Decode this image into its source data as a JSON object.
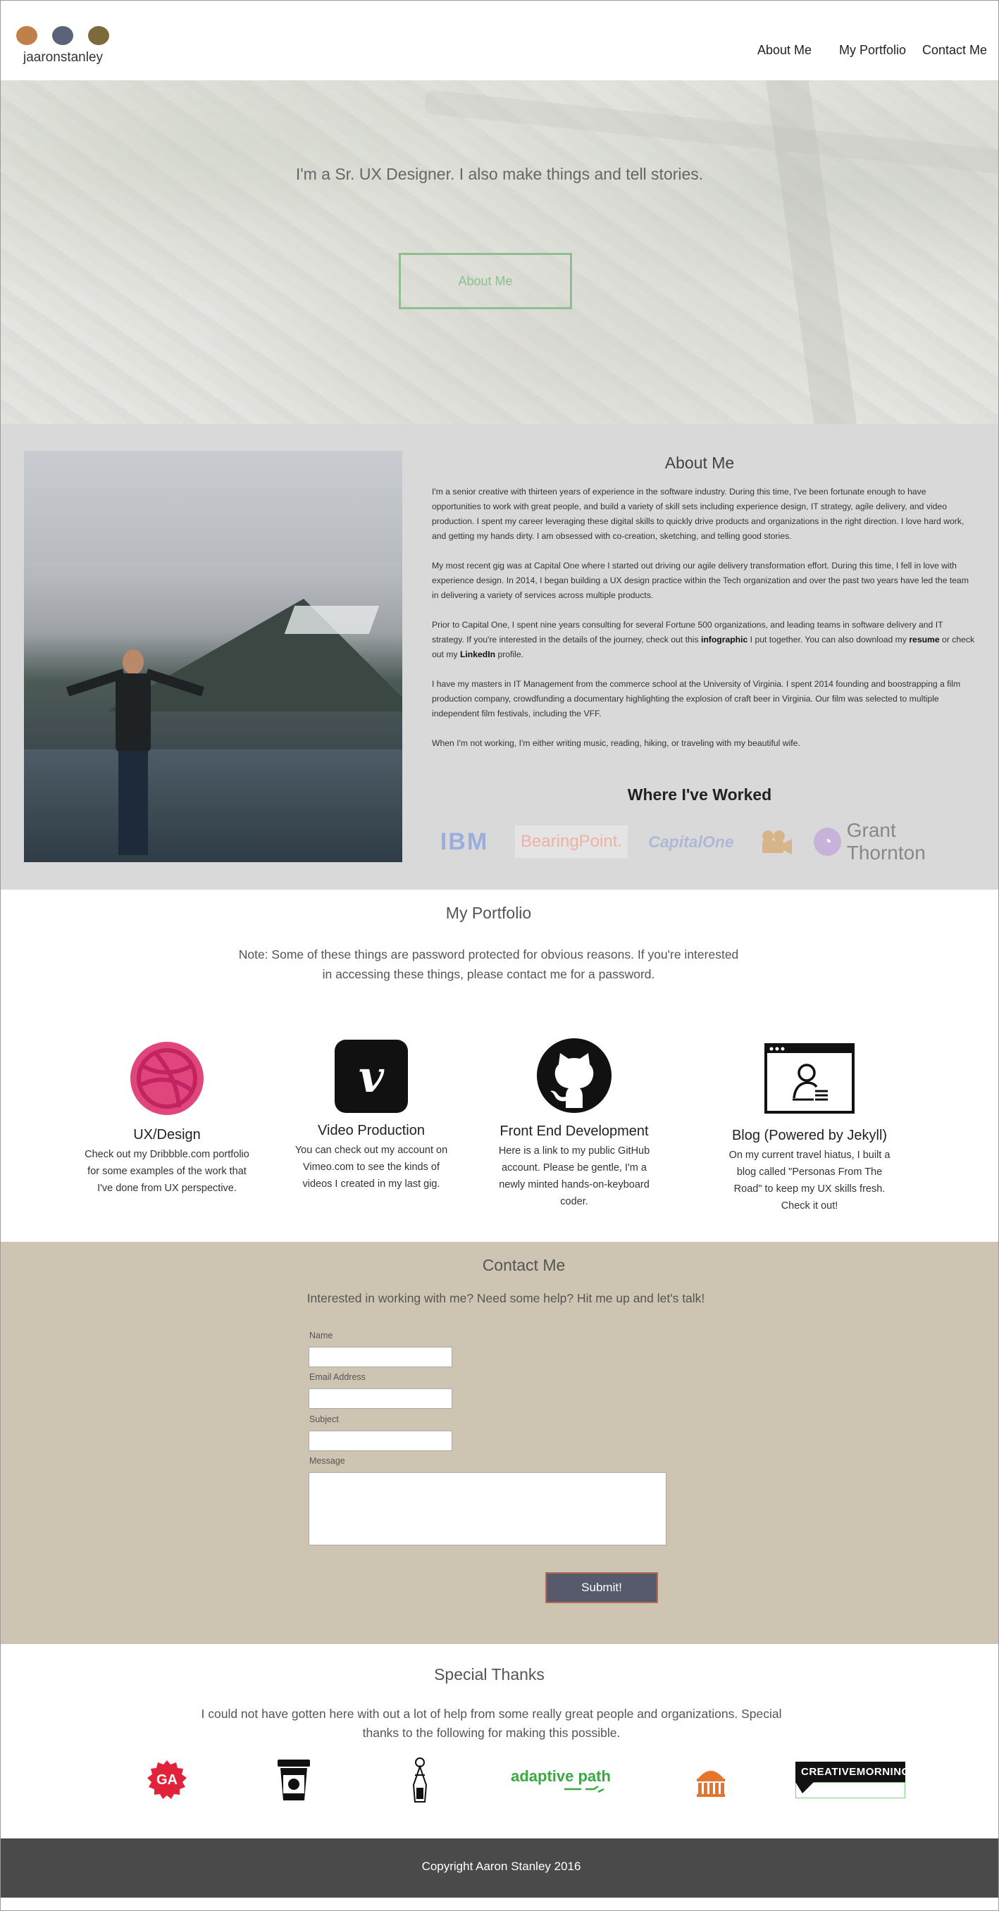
{
  "header": {
    "brand": "jaaronstanley",
    "dot_colors": [
      "#c0804a",
      "#5b6378",
      "#7c6a3a"
    ],
    "nav": [
      "About Me",
      "My Portfolio",
      "Contact Me"
    ]
  },
  "hero": {
    "tagline": "I'm a Sr. UX Designer.  I also make things and tell stories.",
    "button": "About Me"
  },
  "about": {
    "title": "About Me",
    "p1": "I'm a senior creative with thirteen years of experience in the software industry.   During this time, I've been fortunate enough to have opportunities to work with great people, and build a variety of skill sets including experience design, IT strategy, agile delivery, and video production.  I spent my career leveraging these digital skills to quickly drive products and organizations in the right direction.  I love hard work, and getting my hands dirty.  I am obsessed with co-creation, sketching, and telling good stories.",
    "p2": "My most recent gig was at Capital One where I started out driving our agile delivery transformation effort.  During this time, I fell in love with experience design.  In 2014, I began building a UX design practice within the Tech organization and over the past two years have led the team in delivering a variety of services across multiple products.",
    "p3_a": "Prior to Capital One,  I spent nine years consulting for several Fortune 500 organizations, and leading teams in software delivery and IT strategy.  If you're interested in the details of the journey, check out this ",
    "p3_link1": "infographic",
    "p3_b": " I put together.  You can also download my ",
    "p3_link2": "resume",
    "p3_c": " or check out my ",
    "p3_link3": "LinkedIn",
    "p3_d": " profile.",
    "p4": "I have my masters in IT Management from the commerce school at the  University of Virginia.  I spent 2014 founding and boostrapping a film production company, crowdfunding a documentary highlighting the explosion of craft beer in Virginia.  Our film was selected to multiple independent film festivals, including the VFF.",
    "p5": "When I'm not working, I'm either writing music, reading, hiking, or traveling with my beautiful wife.",
    "worked_title": "Where I've Worked",
    "logos": {
      "ibm": "IBM",
      "bearingpoint": "BearingPoint.",
      "capitalone": "CapitalOne",
      "grantthornton": "Grant Thornton"
    }
  },
  "portfolio": {
    "title": "My Portfolio",
    "note": "Note:  Some of these things are password protected for obvious reasons.  If you're interested in accessing these things, please contact me for a password.",
    "items": [
      {
        "caption": "UX/Design",
        "desc": "Check out my Dribbble.com portfolio for some examples of the work that I've done from  UX perspective.",
        "icon": "dribbble-icon"
      },
      {
        "caption": "Video Production",
        "desc": "You can check out my account on Vimeo.com to see the kinds of videos I created in my last gig.",
        "icon": "vimeo-icon"
      },
      {
        "caption": "Front End Development",
        "desc": "Here is a link to my public GitHub account. Please be gentle, I'm a newly minted hands-on-keyboard coder.",
        "icon": "github-icon"
      },
      {
        "caption": "Blog (Powered by Jekyll)",
        "desc": "On my current travel hiatus, I built a blog called \"Personas From The Road\" to keep my UX skills fresh. Check it out!",
        "icon": "blog-icon"
      }
    ]
  },
  "contact": {
    "title": "Contact Me",
    "subtitle": "Interested in working with me?  Need some help?  Hit me up and let's talk!",
    "name_label": "Name",
    "email_label": "Email Address",
    "subject_label": "Subject",
    "message_label": "Message",
    "submit": "Submit!"
  },
  "thanks": {
    "title": "Special Thanks",
    "text": "I could not have gotten here with out a lot of help from some really great people and organizations. Special thanks to the following for making this possible.",
    "logos": {
      "ga": "GA",
      "adaptive_path": "adaptive path",
      "creative_mornings": "CREATIVEMORNINGS"
    }
  },
  "footer": {
    "copyright": "Copyright Aaron Stanley 2016"
  }
}
